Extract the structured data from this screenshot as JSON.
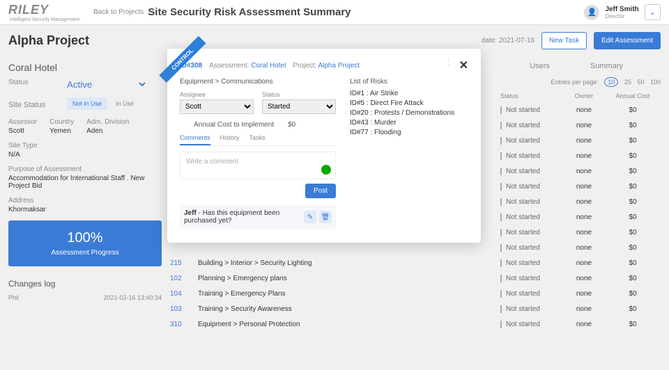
{
  "header": {
    "logo": "RILEY",
    "logo_sub": "Intelligent Security Management",
    "back": "Back to Projects",
    "title": "Site Security Risk Assessment Summary",
    "user_name": "Jeff Smith",
    "user_role": "Director"
  },
  "topbar": {
    "project": "Alpha Project",
    "date_label": "date:",
    "date_value": "2021-07-16",
    "new_task": "New Task",
    "edit": "Edit Assessment"
  },
  "sub_title": "Coral Hotel",
  "tabs": [
    "Users",
    "Summary"
  ],
  "sidebar": {
    "status_label": "Status",
    "status_value": "Active",
    "sitestatus_label": "Site Status",
    "ss_notinuse": "Not in Use",
    "ss_inuse": "In Use",
    "assessor_label": "Assessor",
    "assessor_value": "Scott",
    "country_label": "Country",
    "country_value": "Yemen",
    "admdiv_label": "Adm. Division",
    "admdiv_value": "Aden",
    "sitetype_label": "Site Type",
    "sitetype_value": "N/A",
    "purpose_label": "Purpose of Assessment",
    "purpose_value": "Accommodation for International Staff . New Project Bid",
    "address_label": "Address",
    "address_value": "Khormaksar",
    "progress_pct": "100%",
    "progress_lbl": "Assessment Progress",
    "changes_hdr": "Changes log",
    "change_user": "Phil",
    "change_time": "2021-02-16 13:40:34"
  },
  "table": {
    "entries_label": "Entries per page:",
    "pages": [
      "10",
      "25",
      "50",
      "100"
    ],
    "headers": {
      "status": "Status",
      "owner": "Owner",
      "cost": "Annual Cost"
    },
    "rows": [
      {
        "id": "",
        "path": "",
        "status": "Not started",
        "owner": "none",
        "cost": "$0"
      },
      {
        "id": "",
        "path": "",
        "status": "Not started",
        "owner": "none",
        "cost": "$0"
      },
      {
        "id": "",
        "path": "",
        "status": "Not started",
        "owner": "none",
        "cost": "$0"
      },
      {
        "id": "",
        "path": "",
        "status": "Not started",
        "owner": "none",
        "cost": "$0"
      },
      {
        "id": "",
        "path": "",
        "status": "Not started",
        "owner": "none",
        "cost": "$0"
      },
      {
        "id": "",
        "path": "",
        "status": "Not started",
        "owner": "none",
        "cost": "$0"
      },
      {
        "id": "",
        "path": "",
        "status": "Not started",
        "owner": "none",
        "cost": "$0"
      },
      {
        "id": "",
        "path": "",
        "status": "Not started",
        "owner": "none",
        "cost": "$0"
      },
      {
        "id": "",
        "path": "",
        "status": "Not started",
        "owner": "none",
        "cost": "$0"
      },
      {
        "id": "",
        "path": "",
        "status": "Not started",
        "owner": "none",
        "cost": "$0"
      },
      {
        "id": "215",
        "path": "Building > Interior > Security Lighting",
        "status": "Not started",
        "owner": "none",
        "cost": "$0"
      },
      {
        "id": "102",
        "path": "Planning > Emergency plans",
        "status": "Not started",
        "owner": "none",
        "cost": "$0"
      },
      {
        "id": "104",
        "path": "Training > Emergency Plans",
        "status": "Not started",
        "owner": "none",
        "cost": "$0"
      },
      {
        "id": "103",
        "path": "Training > Security Awareness",
        "status": "Not started",
        "owner": "none",
        "cost": "$0"
      },
      {
        "id": "310",
        "path": "Equipment > Personal Protection",
        "status": "Not started",
        "owner": "none",
        "cost": "$0"
      }
    ]
  },
  "modal": {
    "ribbon": "CONTROL",
    "id": "ID#308",
    "asmt_label": "Assessment:",
    "asmt_value": "Coral Hotel",
    "proj_label": "Project:",
    "proj_value": "Alpha Project",
    "breadcrumb": "Equipment > Communications",
    "assignee_label": "Assignee",
    "assignee_value": "Scott",
    "status_label": "Status",
    "status_value": "Started",
    "cost_label": "Annual Cost to Implement",
    "cost_value": "$0",
    "tabs": {
      "comments": "Comments",
      "history": "History",
      "tasks": "Tasks"
    },
    "comment_placeholder": "Write a comment",
    "post": "Post",
    "entry_author": "Jeff",
    "entry_text": "Has this equipment been purchased yet?",
    "risks_hdr": "List of Risks",
    "risks": [
      "ID#1 : Air Strike",
      "ID#5 : Direct Fire Attack",
      "ID#20 : Protests / Demonstrations",
      "ID#43 : Murder",
      "ID#77 : Flooding"
    ]
  }
}
